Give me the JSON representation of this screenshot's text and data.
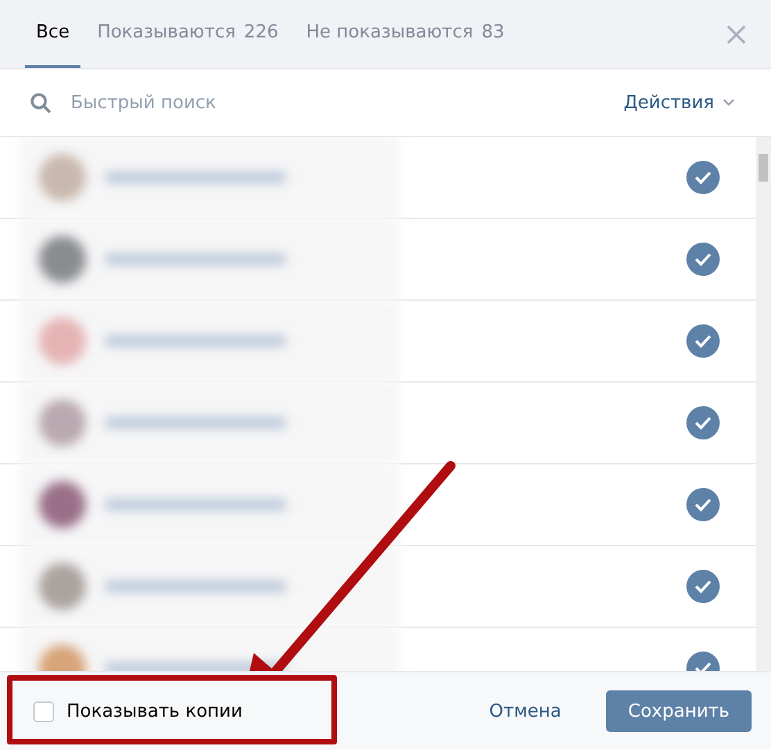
{
  "tabs": [
    {
      "label": "Все",
      "selected": true
    },
    {
      "label": "Показываются",
      "count": "226",
      "selected": false
    },
    {
      "label": "Не показываются",
      "count": "83",
      "selected": false
    }
  ],
  "search": {
    "placeholder": "Быстрый поиск"
  },
  "actions": "Действия",
  "rows": [
    {
      "checked": true
    },
    {
      "checked": true
    },
    {
      "checked": true
    },
    {
      "checked": true
    },
    {
      "checked": true
    },
    {
      "checked": true
    },
    {
      "checked": true
    }
  ],
  "footer": {
    "show_copies": {
      "label": "Показывать копии",
      "checked": false
    },
    "cancel": "Отмена",
    "save": "Сохранить"
  }
}
